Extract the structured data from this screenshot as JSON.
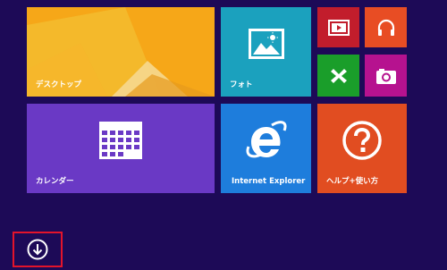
{
  "tiles": {
    "desktop": {
      "label": "デスクトップ"
    },
    "photos": {
      "label": "フォト"
    },
    "calendar": {
      "label": "カレンダー"
    },
    "ie": {
      "label": "Internet Explorer"
    },
    "help": {
      "label": "ヘルプ+使い方"
    }
  },
  "icons": {
    "video": "video-icon",
    "music": "headphones-icon",
    "games": "gamepad-icon",
    "camera": "camera-icon",
    "apps": "down-arrow-icon"
  },
  "colors": {
    "background": "#1d0a57",
    "desktop": "#f4a21a",
    "photos": "#1ba1be",
    "video": "#c21d2c",
    "music": "#e84d24",
    "games": "#1a9e2a",
    "camera": "#b6128f",
    "calendar": "#6a39c5",
    "ie": "#1e7ddc",
    "help": "#e14d21",
    "highlight": "#e3142b"
  }
}
